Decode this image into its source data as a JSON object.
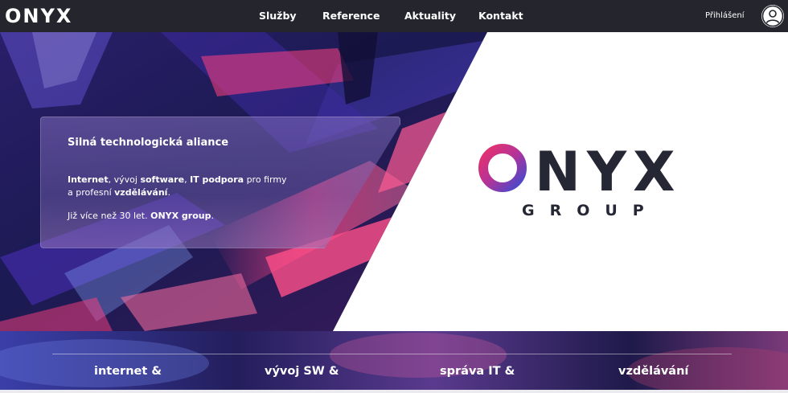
{
  "brand": {
    "logo_text": "ONYX"
  },
  "nav": {
    "items": [
      "Služby",
      "Reference",
      "Aktuality",
      "Kontakt"
    ],
    "login_label": "Přihlášení"
  },
  "hero": {
    "title": "Silná technologická aliance",
    "line1": {
      "internet": "Internet",
      "sep1": ", vývoj ",
      "software": "software",
      "sep2": ", ",
      "it_support": "IT podpora",
      "tail": " pro firmy"
    },
    "line2": {
      "head": "a profesní ",
      "education": "vzdělávání",
      "tail": "."
    },
    "line3": {
      "head": "Již více než 30 let. ",
      "group": "ONYX group",
      "tail": "."
    }
  },
  "group_logo": {
    "word": "ONYX",
    "sub": "GROUP"
  },
  "services": [
    "internet  &",
    "vývoj SW  &",
    "správa IT  &",
    "vzdělávání"
  ],
  "colors": {
    "navbar": "#25262d",
    "logo_dark": "#262735",
    "logo_gradient_start": "#e8326b",
    "logo_gradient_end": "#3f4ad0",
    "hero_dark": "#1b1a52"
  },
  "icons": {
    "user": "user-circle-icon"
  }
}
